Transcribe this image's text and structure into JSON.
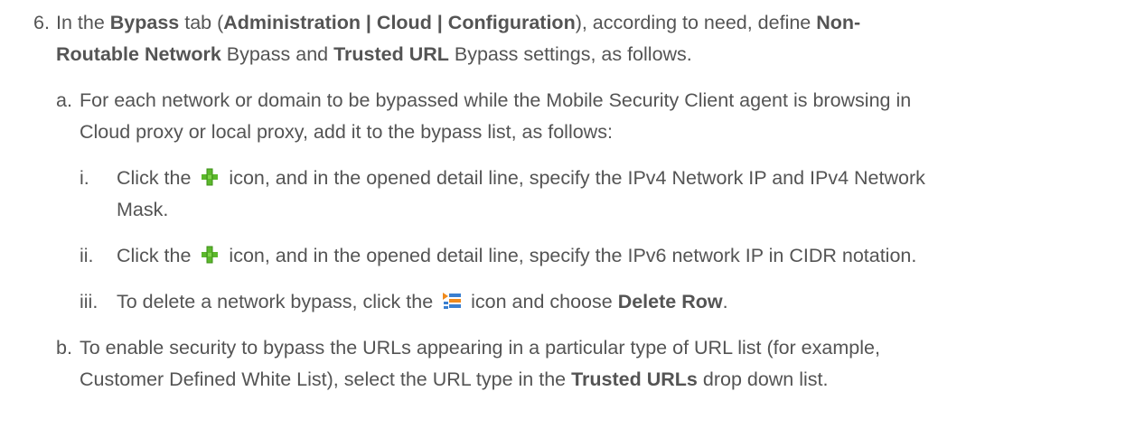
{
  "step6": {
    "marker": "6.",
    "line1": [
      "In the ",
      "Bypass",
      " tab (",
      "Administration | Cloud | Configuration",
      "), according to need, define ",
      "Non-"
    ],
    "line2": [
      "Routable Network",
      " Bypass and ",
      "Trusted URL",
      " Bypass settings, as follows."
    ]
  },
  "step_a": {
    "marker": "a.",
    "line1": "For each network or domain to be bypassed while the Mobile Security Client agent is browsing in",
    "line2": "Cloud proxy or local proxy, add it to the bypass list, as follows:"
  },
  "step_i": {
    "marker": "i.",
    "before_icon": "Click the",
    "icon": "green-plus-icon",
    "after_icon": "icon, and in the opened detail line, specify the IPv4 Network IP and IPv4 Network",
    "line2": "Mask."
  },
  "step_ii": {
    "marker": "ii.",
    "before_icon": "Click the",
    "icon": "green-plus-icon",
    "after_icon": "icon, and in the opened detail line, specify the IPv6 network IP in CIDR notation."
  },
  "step_iii": {
    "marker": "iii.",
    "before_icon": "To delete a network bypass, click the",
    "icon": "row-menu-icon",
    "after_icon": "icon and choose ",
    "bold": "Delete Row",
    "end": "."
  },
  "step_b": {
    "marker": "b.",
    "line1": "To enable security to bypass the URLs appearing in a particular type of URL list (for example,",
    "line2": [
      "Customer Defined White List), select the URL type in the ",
      "Trusted URLs",
      " drop down list."
    ]
  },
  "colors": {
    "text": "#545454",
    "plus_green": "#5cb82c",
    "menu_orange": "#f08a1c",
    "menu_blue": "#3a7fd0"
  }
}
